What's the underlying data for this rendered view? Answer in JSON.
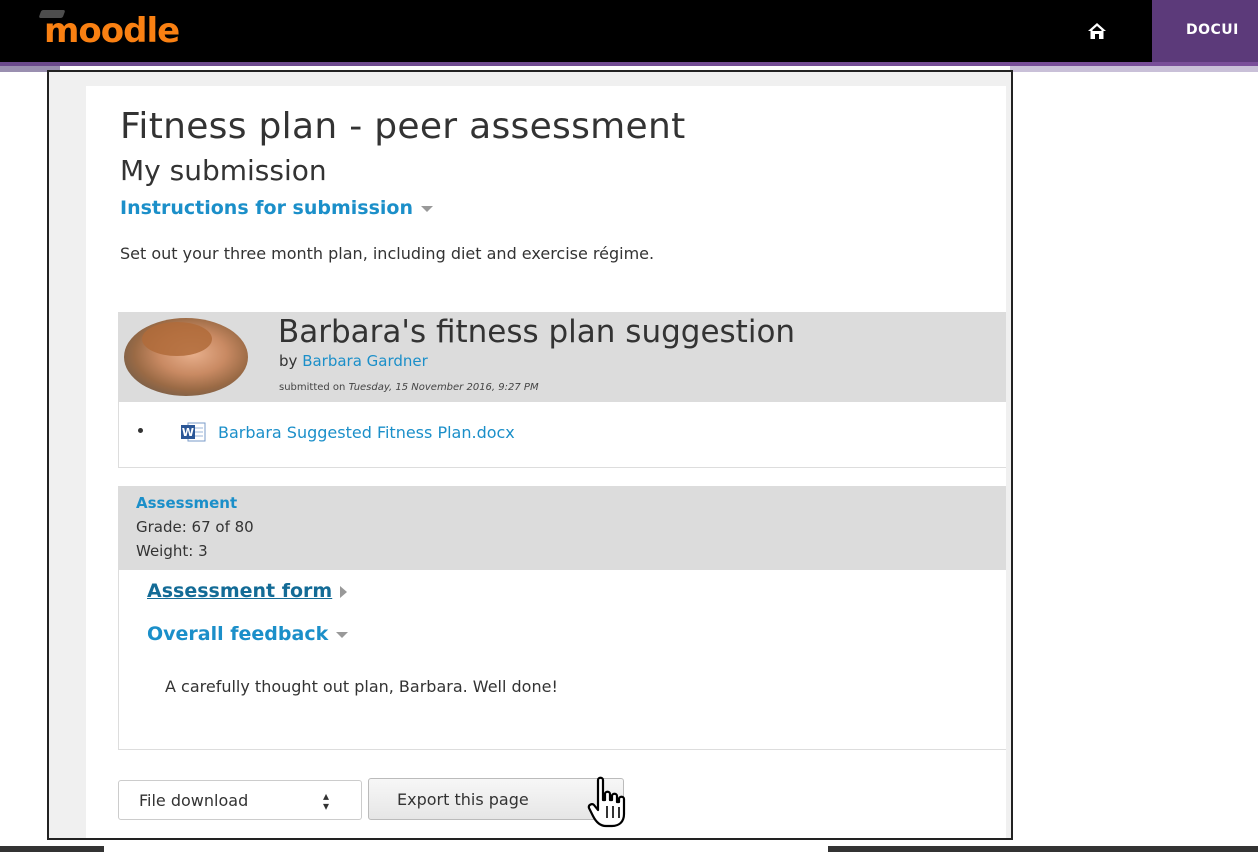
{
  "header": {
    "logo_text": "moodle",
    "docs_label": "DOCUI"
  },
  "page": {
    "title": "Fitness plan - peer assessment",
    "subtitle": "My submission",
    "instructions_toggle": "Instructions for submission",
    "instructions_text": "Set out your three month plan, including diet and exercise régime."
  },
  "submission": {
    "title": "Barbara's fitness plan suggestion",
    "by_label": "by",
    "author": "Barbara Gardner",
    "submitted_label": "submitted on",
    "submitted_date": "Tuesday, 15 November 2016, 9:27 PM",
    "attachment": "Barbara Suggested Fitness Plan.docx"
  },
  "assessment": {
    "heading": "Assessment",
    "grade": "Grade: 67 of 80",
    "weight": "Weight: 3",
    "form_link": "Assessment form",
    "feedback_toggle": "Overall feedback",
    "feedback_text": "A carefully thought out plan, Barbara. Well done!"
  },
  "controls": {
    "download_select": "File download",
    "export_button": "Export this page"
  },
  "colors": {
    "brand_orange": "#f98012",
    "link_blue": "#1b8fc9",
    "nav_purple": "#5c3a7a"
  }
}
